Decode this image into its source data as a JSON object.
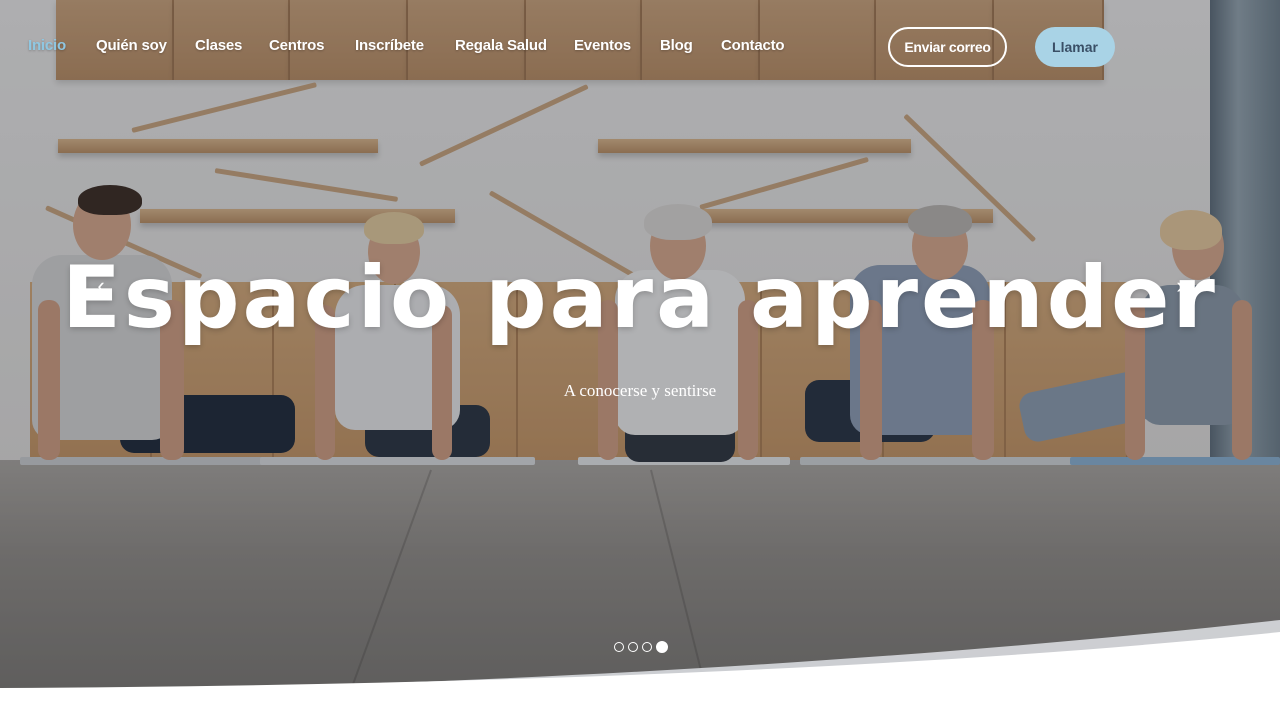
{
  "nav": {
    "items": [
      {
        "label": "Inicio",
        "active": true
      },
      {
        "label": "Quién soy"
      },
      {
        "label": "Clases"
      },
      {
        "label": "Centros"
      },
      {
        "label": "Inscríbete"
      },
      {
        "label": "Regala Salud"
      },
      {
        "label": "Eventos"
      },
      {
        "label": "Blog"
      },
      {
        "label": "Contacto"
      }
    ],
    "email_button": "Enviar correo",
    "call_button": "Llamar"
  },
  "hero": {
    "title": "Espacio para aprender",
    "subtitle": "A conocerse y sentirse",
    "prev_icon": "chevron-left-icon",
    "next_icon": "chevron-right-icon",
    "prev_glyph": "‹",
    "next_glyph": "›"
  },
  "carousel": {
    "slide_count": 4,
    "active_slide": 4
  },
  "colors": {
    "active_nav": "#8fc7e2",
    "call_button_bg": "#a9d3e6",
    "call_button_text": "#3a4f66"
  }
}
